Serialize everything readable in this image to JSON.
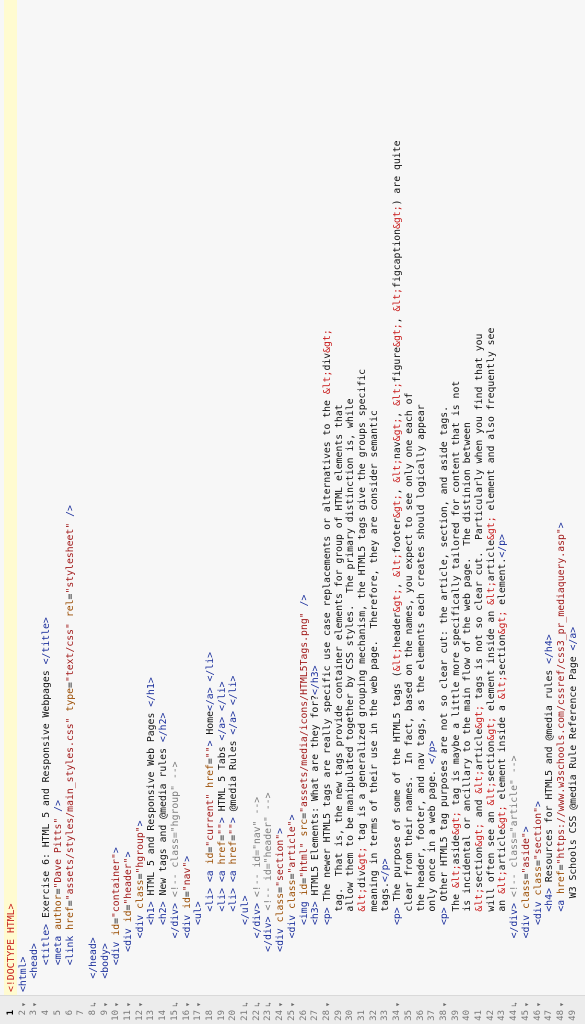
{
  "editor": {
    "active_line": 1,
    "fold_glyphs": {
      "open": "▾",
      "end": "↳"
    },
    "lines": [
      {
        "n": 1,
        "indent": 0,
        "text": "<!DOCTYPE HTML>",
        "kind": "doctype"
      },
      {
        "n": 2,
        "indent": 0,
        "text": "<html>",
        "fold": "open"
      },
      {
        "n": 3,
        "indent": 1,
        "text": "<head>",
        "fold": "open"
      },
      {
        "n": 4,
        "indent": 2,
        "text": "<title> Exercise 6: HTML 5 and Responsive Webpages </title>"
      },
      {
        "n": 5,
        "indent": 2,
        "text": "<meta author=\"Dave Pitts\" />"
      },
      {
        "n": 6,
        "indent": 2,
        "text": "<link href=\"assets/styles/main_styles.css\" type=\"text/css\" rel=\"stylesheet\" />"
      },
      {
        "n": 7,
        "indent": 0,
        "text": ""
      },
      {
        "n": 8,
        "indent": 1,
        "text": "</head>",
        "fold": "end"
      },
      {
        "n": 9,
        "indent": 1,
        "text": "<body>",
        "fold": "open"
      },
      {
        "n": 10,
        "indent": 2,
        "text": "<div id=\"container\">",
        "fold": "open"
      },
      {
        "n": 11,
        "indent": 3,
        "text": "<div id=\"header\">",
        "fold": "open"
      },
      {
        "n": 12,
        "indent": 4,
        "text": "<div class=\"hgroup\">",
        "fold": "open"
      },
      {
        "n": 13,
        "indent": 5,
        "text": "<h1> HTML 5 and Responsive Web Pages </h1>"
      },
      {
        "n": 14,
        "indent": 5,
        "text": "<h2> New tags and @media rules </h2>"
      },
      {
        "n": 15,
        "indent": 4,
        "text": "</div> <!-- class=\"hgroup\" -->",
        "fold": "end"
      },
      {
        "n": 16,
        "indent": 4,
        "text": "<div id=\"nav\">",
        "fold": "open"
      },
      {
        "n": 17,
        "indent": 5,
        "text": "<ul>",
        "fold": "open"
      },
      {
        "n": 18,
        "indent": 6,
        "text": "<li> <a id=\"current\" href=\"\"> Home</a> </li>"
      },
      {
        "n": 19,
        "indent": 6,
        "text": "<li> <a href=\"\"> HTML 5 Tabs </a> </li>"
      },
      {
        "n": 20,
        "indent": 6,
        "text": "<li> <a href=\"\"> @media Rules </a> </li>"
      },
      {
        "n": 21,
        "indent": 5,
        "text": "</ul>",
        "fold": "end"
      },
      {
        "n": 22,
        "indent": 4,
        "text": "</div> <!-- id=\"nav\" -->",
        "fold": "end"
      },
      {
        "n": 23,
        "indent": 3,
        "text": "</div> <!-- id=\"header\" -->",
        "fold": "end"
      },
      {
        "n": 24,
        "indent": 3,
        "text": "<div class=\"section\">",
        "fold": "open"
      },
      {
        "n": 25,
        "indent": 4,
        "text": "<div class=\"article\">",
        "fold": "open"
      },
      {
        "n": 26,
        "indent": 5,
        "text": "<img id=\"html\" src=\"assets/media/icons/HTML5Tags.png\" />"
      },
      {
        "n": 27,
        "indent": 5,
        "text": "<h3> HTML5 Elements: What are they for?</h3>"
      },
      {
        "n": 28,
        "indent": 5,
        "text": "<p> The newer HTML5 tags are really specific use case replacements or alternatives to the &lt;div&gt;",
        "fold": "open"
      },
      {
        "n": 29,
        "indent": 6,
        "text": "tag.  That is, the new tags provide container elements for group of HTML elements that"
      },
      {
        "n": 30,
        "indent": 6,
        "text": "allow them to be manipulated together by CSS styles.  The primary distinction is, while"
      },
      {
        "n": 31,
        "indent": 6,
        "text": "&lt;div&gt; tag is a generalized grouping mechanism, the HTML5 tags give the groups specific"
      },
      {
        "n": 32,
        "indent": 6,
        "text": "meaning in terms of their use in the web page.  Therefore, they are consider semantic"
      },
      {
        "n": 33,
        "indent": 6,
        "text": "tags.</p>"
      },
      {
        "n": 34,
        "indent": 5,
        "text": "<p> The purpose of some of the HTML5 tags (&lt;header&gt;, &lt;footer&gt;, &lt;nav&gt;, &lt;figure&gt;, &lt;figcaption&gt;) are quite",
        "fold": "open"
      },
      {
        "n": 35,
        "indent": 6,
        "text": "clear from their names.  In fact, based on the names, you expect to see only one each of"
      },
      {
        "n": 36,
        "indent": 6,
        "text": "the header, footer, and nav tags, as the elements each creates should logically appear"
      },
      {
        "n": 37,
        "indent": 6,
        "text": "only once in a web page. </p>"
      },
      {
        "n": 38,
        "indent": 5,
        "text": "<p> Other HTML5 tag purposes are not so clear cut: the article, section, and aside tags.",
        "fold": "open"
      },
      {
        "n": 39,
        "indent": 6,
        "text": "The &lt;aside&gt; tag is maybe a little more specifically tailored for content that is not"
      },
      {
        "n": 40,
        "indent": 6,
        "text": "is incidental or ancillary to the main flow of the web page.  The distinion between"
      },
      {
        "n": 41,
        "indent": 6,
        "text": "&lt;section&gt; and &lt;article&gt; tags is not so clear cut.  Particularly when you find that you"
      },
      {
        "n": 42,
        "indent": 6,
        "text": "will often see an &lt;section&gt; element inside an &lt;article&gt; element and also frequently see"
      },
      {
        "n": 43,
        "indent": 6,
        "text": "an &lt;article&gt; element inside a &lt;section&gt; element.</p>"
      },
      {
        "n": 44,
        "indent": 4,
        "text": "</div> <!-- class=\"article\" -->",
        "fold": "end"
      },
      {
        "n": 45,
        "indent": 4,
        "text": "<div class=\"aside\">",
        "fold": "open"
      },
      {
        "n": 46,
        "indent": 5,
        "text": "<div class=\"section\">",
        "fold": "open"
      },
      {
        "n": 47,
        "indent": 6,
        "text": "<h4> Resources for HTML5 and @media rules </h4>"
      },
      {
        "n": 48,
        "indent": 6,
        "text": "<a href=\"https://www.w3schools.com/cssref/css3_pr_mediaquery.asp\">",
        "fold": "open"
      },
      {
        "n": 49,
        "indent": 7,
        "text": "W3 Schools CSS @media Rule Reference Page </a>"
      }
    ]
  }
}
